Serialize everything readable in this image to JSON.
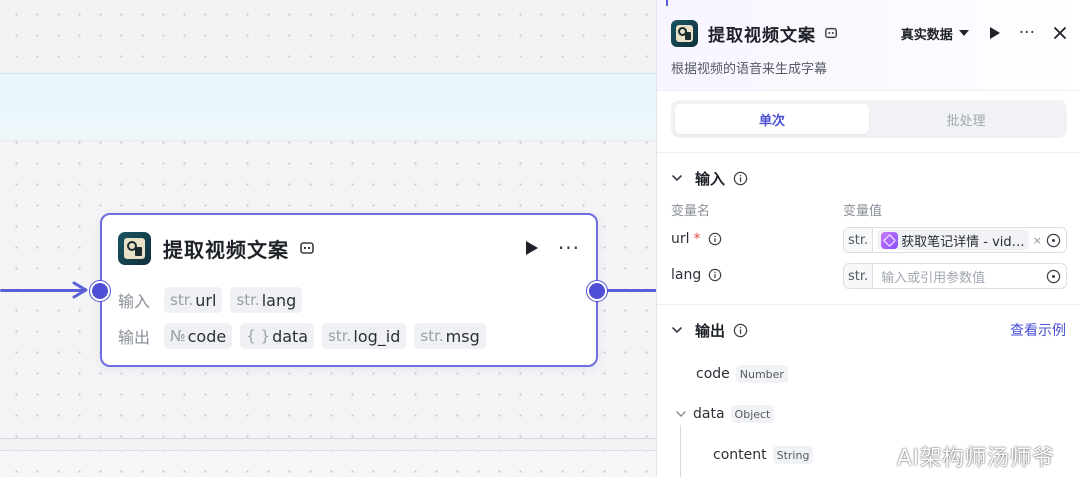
{
  "node": {
    "title": "提取视频文案",
    "inputs_label": "输入",
    "outputs_label": "输出",
    "inputs": [
      {
        "type": "str.",
        "name": "url"
      },
      {
        "type": "str.",
        "name": "lang"
      }
    ],
    "outputs": [
      {
        "type": "№",
        "name": "code"
      },
      {
        "type": "{ }",
        "name": "data"
      },
      {
        "type": "str.",
        "name": "log_id"
      },
      {
        "type": "str.",
        "name": "msg"
      }
    ]
  },
  "panel": {
    "title": "提取视频文案",
    "mode": "真实数据",
    "description": "根据视频的语音来生成字幕",
    "tabs": [
      {
        "label": "单次",
        "active": true
      },
      {
        "label": "批处理",
        "active": false
      }
    ],
    "input_section": {
      "title": "输入",
      "col_name": "变量名",
      "col_value": "变量值",
      "vars": [
        {
          "name": "url",
          "required_mark": "*",
          "type": "str.",
          "ref": "获取笔记详情 - vid…",
          "clear": "×"
        },
        {
          "name": "lang",
          "type": "str.",
          "placeholder": "输入或引用参数值"
        }
      ]
    },
    "output_section": {
      "title": "输出",
      "link": "查看示例",
      "fields": [
        {
          "name": "code",
          "type": "Number"
        },
        {
          "name": "data",
          "type": "Object"
        },
        {
          "name": "content",
          "type": "String"
        }
      ]
    }
  },
  "watermark": "AI架构师汤师爷",
  "colors": {
    "accent": "#4e4fd6",
    "node_border": "#6d6de0",
    "link": "#4a4fd4"
  }
}
